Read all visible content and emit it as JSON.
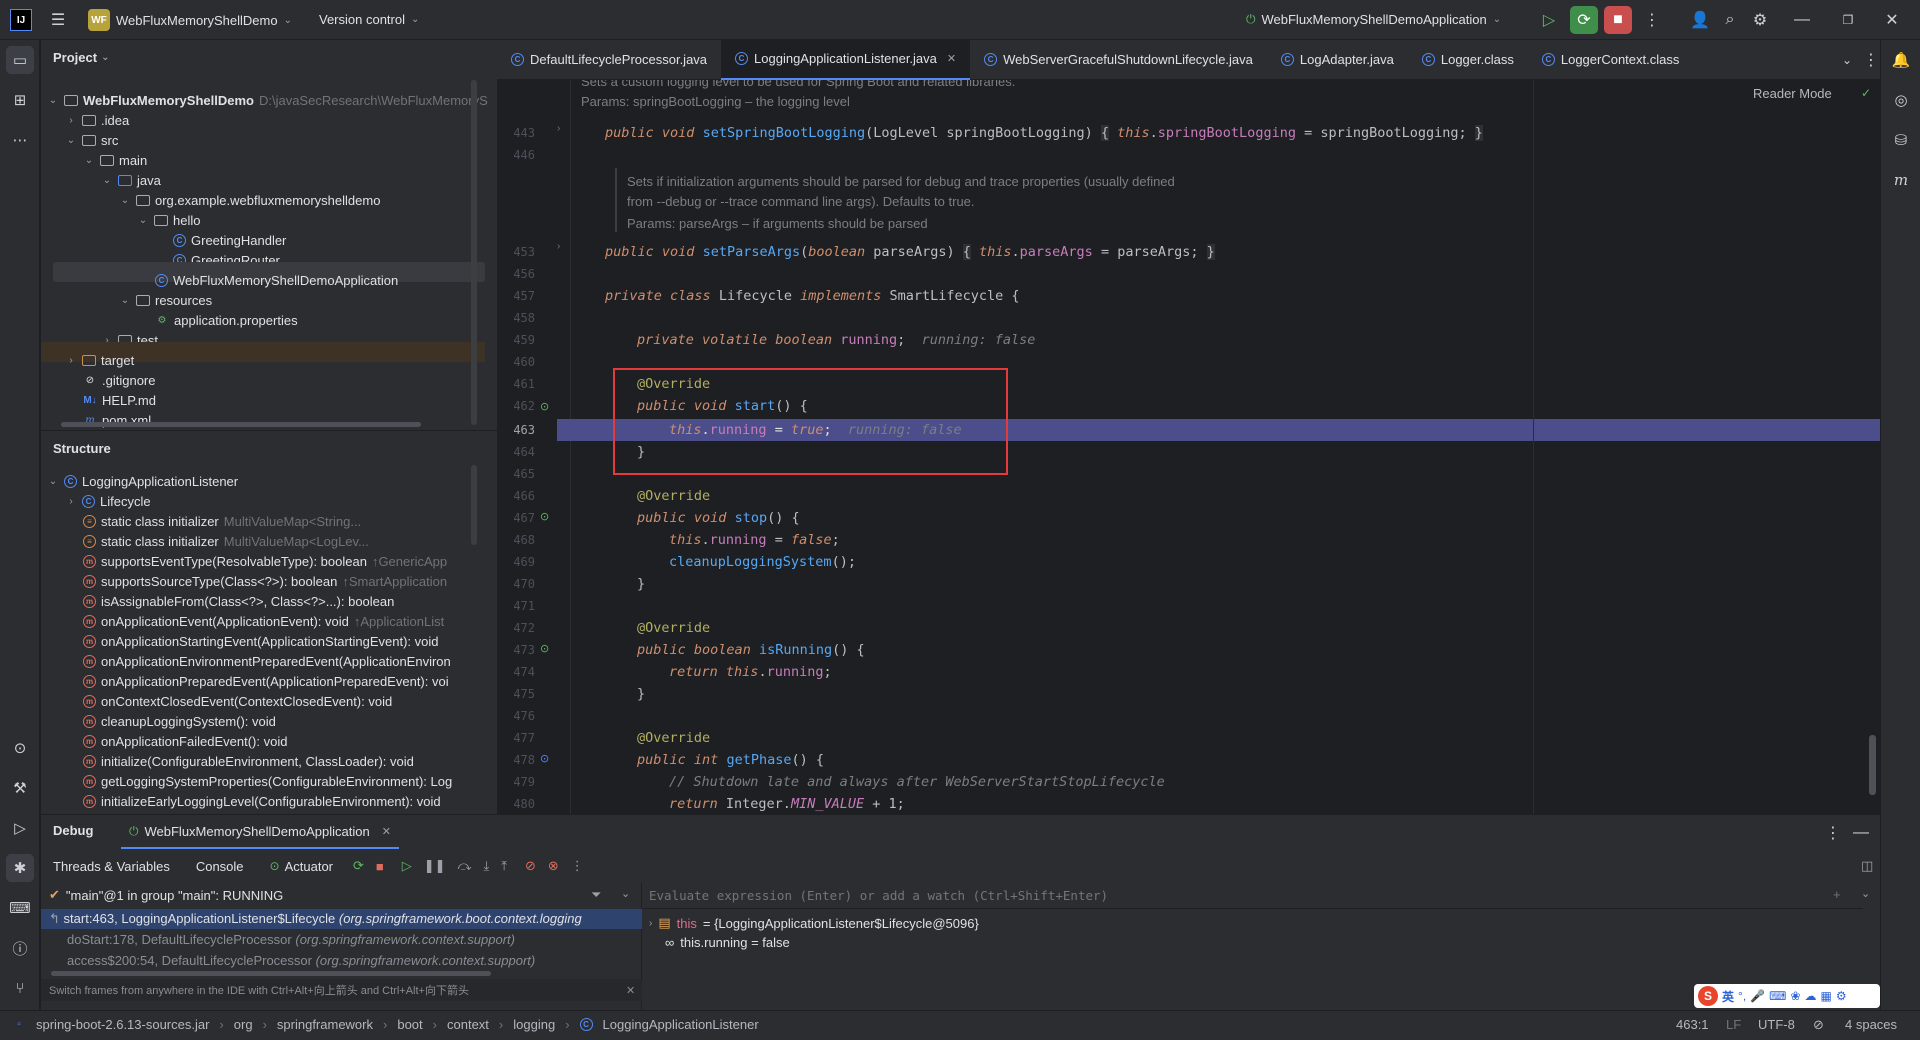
{
  "topbar": {
    "project_badge": "WF",
    "project_name": "WebFluxMemoryShellDemo",
    "vcs": "Version control",
    "run_config": "WebFluxMemoryShellDemoApplication"
  },
  "project_panel": {
    "title": "Project",
    "root_name": "WebFluxMemoryShellDemo",
    "root_path": "D:\\javaSecResearch\\WebFluxMemoryS",
    "items": [
      ".idea",
      "src",
      "main",
      "java",
      "org.example.webfluxmemoryshelldemo",
      "hello",
      "GreetingHandler",
      "GreetingRouter",
      "WebFluxMemoryShellDemoApplication",
      "resources",
      "application.properties",
      "test",
      "target",
      ".gitignore",
      "HELP.md",
      "pom.xml"
    ]
  },
  "structure_panel": {
    "title": "Structure",
    "root": "LoggingApplicationListener",
    "items": [
      {
        "name": "Lifecycle",
        "hint": ""
      },
      {
        "name": "static class initializer",
        "hint": "MultiValueMap<String..."
      },
      {
        "name": "static class initializer",
        "hint": "MultiValueMap<LogLev..."
      },
      {
        "name": "supportsEventType(ResolvableType): boolean",
        "hint": "↑GenericApp"
      },
      {
        "name": "supportsSourceType(Class<?>): boolean",
        "hint": "↑SmartApplication"
      },
      {
        "name": "isAssignableFrom(Class<?>, Class<?>...): boolean",
        "hint": ""
      },
      {
        "name": "onApplicationEvent(ApplicationEvent): void",
        "hint": "↑ApplicationList"
      },
      {
        "name": "onApplicationStartingEvent(ApplicationStartingEvent): void",
        "hint": ""
      },
      {
        "name": "onApplicationEnvironmentPreparedEvent(ApplicationEnviron",
        "hint": ""
      },
      {
        "name": "onApplicationPreparedEvent(ApplicationPreparedEvent): voi",
        "hint": ""
      },
      {
        "name": "onContextClosedEvent(ContextClosedEvent): void",
        "hint": ""
      },
      {
        "name": "cleanupLoggingSystem(): void",
        "hint": ""
      },
      {
        "name": "onApplicationFailedEvent(): void",
        "hint": ""
      },
      {
        "name": "initialize(ConfigurableEnvironment, ClassLoader): void",
        "hint": ""
      },
      {
        "name": "getLoggingSystemProperties(ConfigurableEnvironment): Log",
        "hint": ""
      },
      {
        "name": "initializeEarlyLoggingLevel(ConfigurableEnvironment): void",
        "hint": ""
      }
    ]
  },
  "tabs": [
    "DefaultLifecycleProcessor.java",
    "LoggingApplicationListener.java",
    "WebServerGracefulShutdownLifecycle.java",
    "LogAdapter.java",
    "Logger.class",
    "LoggerContext.class"
  ],
  "editor": {
    "reader_mode": "Reader Mode",
    "doc_top": "Sets a custom logging level to be used for Spring Boot and related libraries.",
    "doc_params1": "Params: springBootLogging – the logging level",
    "doc2_line1": "Sets if initialization arguments should be parsed for debug and trace properties (usually defined",
    "doc2_line2": "from --debug or --trace command line args). Defaults to true.",
    "doc_params2": "Params: parseArgs – if arguments should be parsed",
    "line_numbers": [
      "443",
      "446",
      "453",
      "456",
      "457",
      "458",
      "459",
      "460",
      "461",
      "462",
      "463",
      "464",
      "465",
      "466",
      "467",
      "468",
      "469",
      "470",
      "471",
      "472",
      "473",
      "474",
      "475",
      "476",
      "477",
      "478",
      "479",
      "480"
    ],
    "hint_running_false": "running: false",
    "comment": "// Shutdown late and always after WebServerStartStopLifecycle"
  },
  "debug": {
    "tab_debug": "Debug",
    "tab_session": "WebFluxMemoryShellDemoApplication",
    "subtabs": [
      "Threads & Variables",
      "Console",
      "Actuator"
    ],
    "thread": "\"main\"@1 in group \"main\": RUNNING",
    "frames": [
      {
        "name": "start:463, LoggingApplicationListener$Lifecycle",
        "pkg": "(org.springframework.boot.context.logging"
      },
      {
        "name": "doStart:178, DefaultLifecycleProcessor",
        "pkg": "(org.springframework.context.support)"
      },
      {
        "name": "access$200:54, DefaultLifecycleProcessor",
        "pkg": "(org.springframework.context.support)"
      }
    ],
    "frames_hint": "Switch frames from anywhere in the IDE with Ctrl+Alt+向上箭头 and Ctrl+Alt+向下箭头",
    "eval_placeholder": "Evaluate expression (Enter) or add a watch (Ctrl+Shift+Enter)",
    "var_this_name": "this",
    "var_this_value": "= {LoggingApplicationListener$Lifecycle@5096}",
    "var_running": "this.running = false"
  },
  "statusbar": {
    "crumbs": [
      "spring-boot-2.6.13-sources.jar",
      "org",
      "springframework",
      "boot",
      "context",
      "logging",
      "LoggingApplicationListener"
    ],
    "position": "463:1",
    "line_sep": "LF",
    "encoding": "UTF-8",
    "indent": "4 spaces",
    "ime": "英"
  },
  "colors": {
    "accent": "#548af7",
    "highlight_line": "#4b4e8a",
    "red_box": "#e33b3b"
  }
}
